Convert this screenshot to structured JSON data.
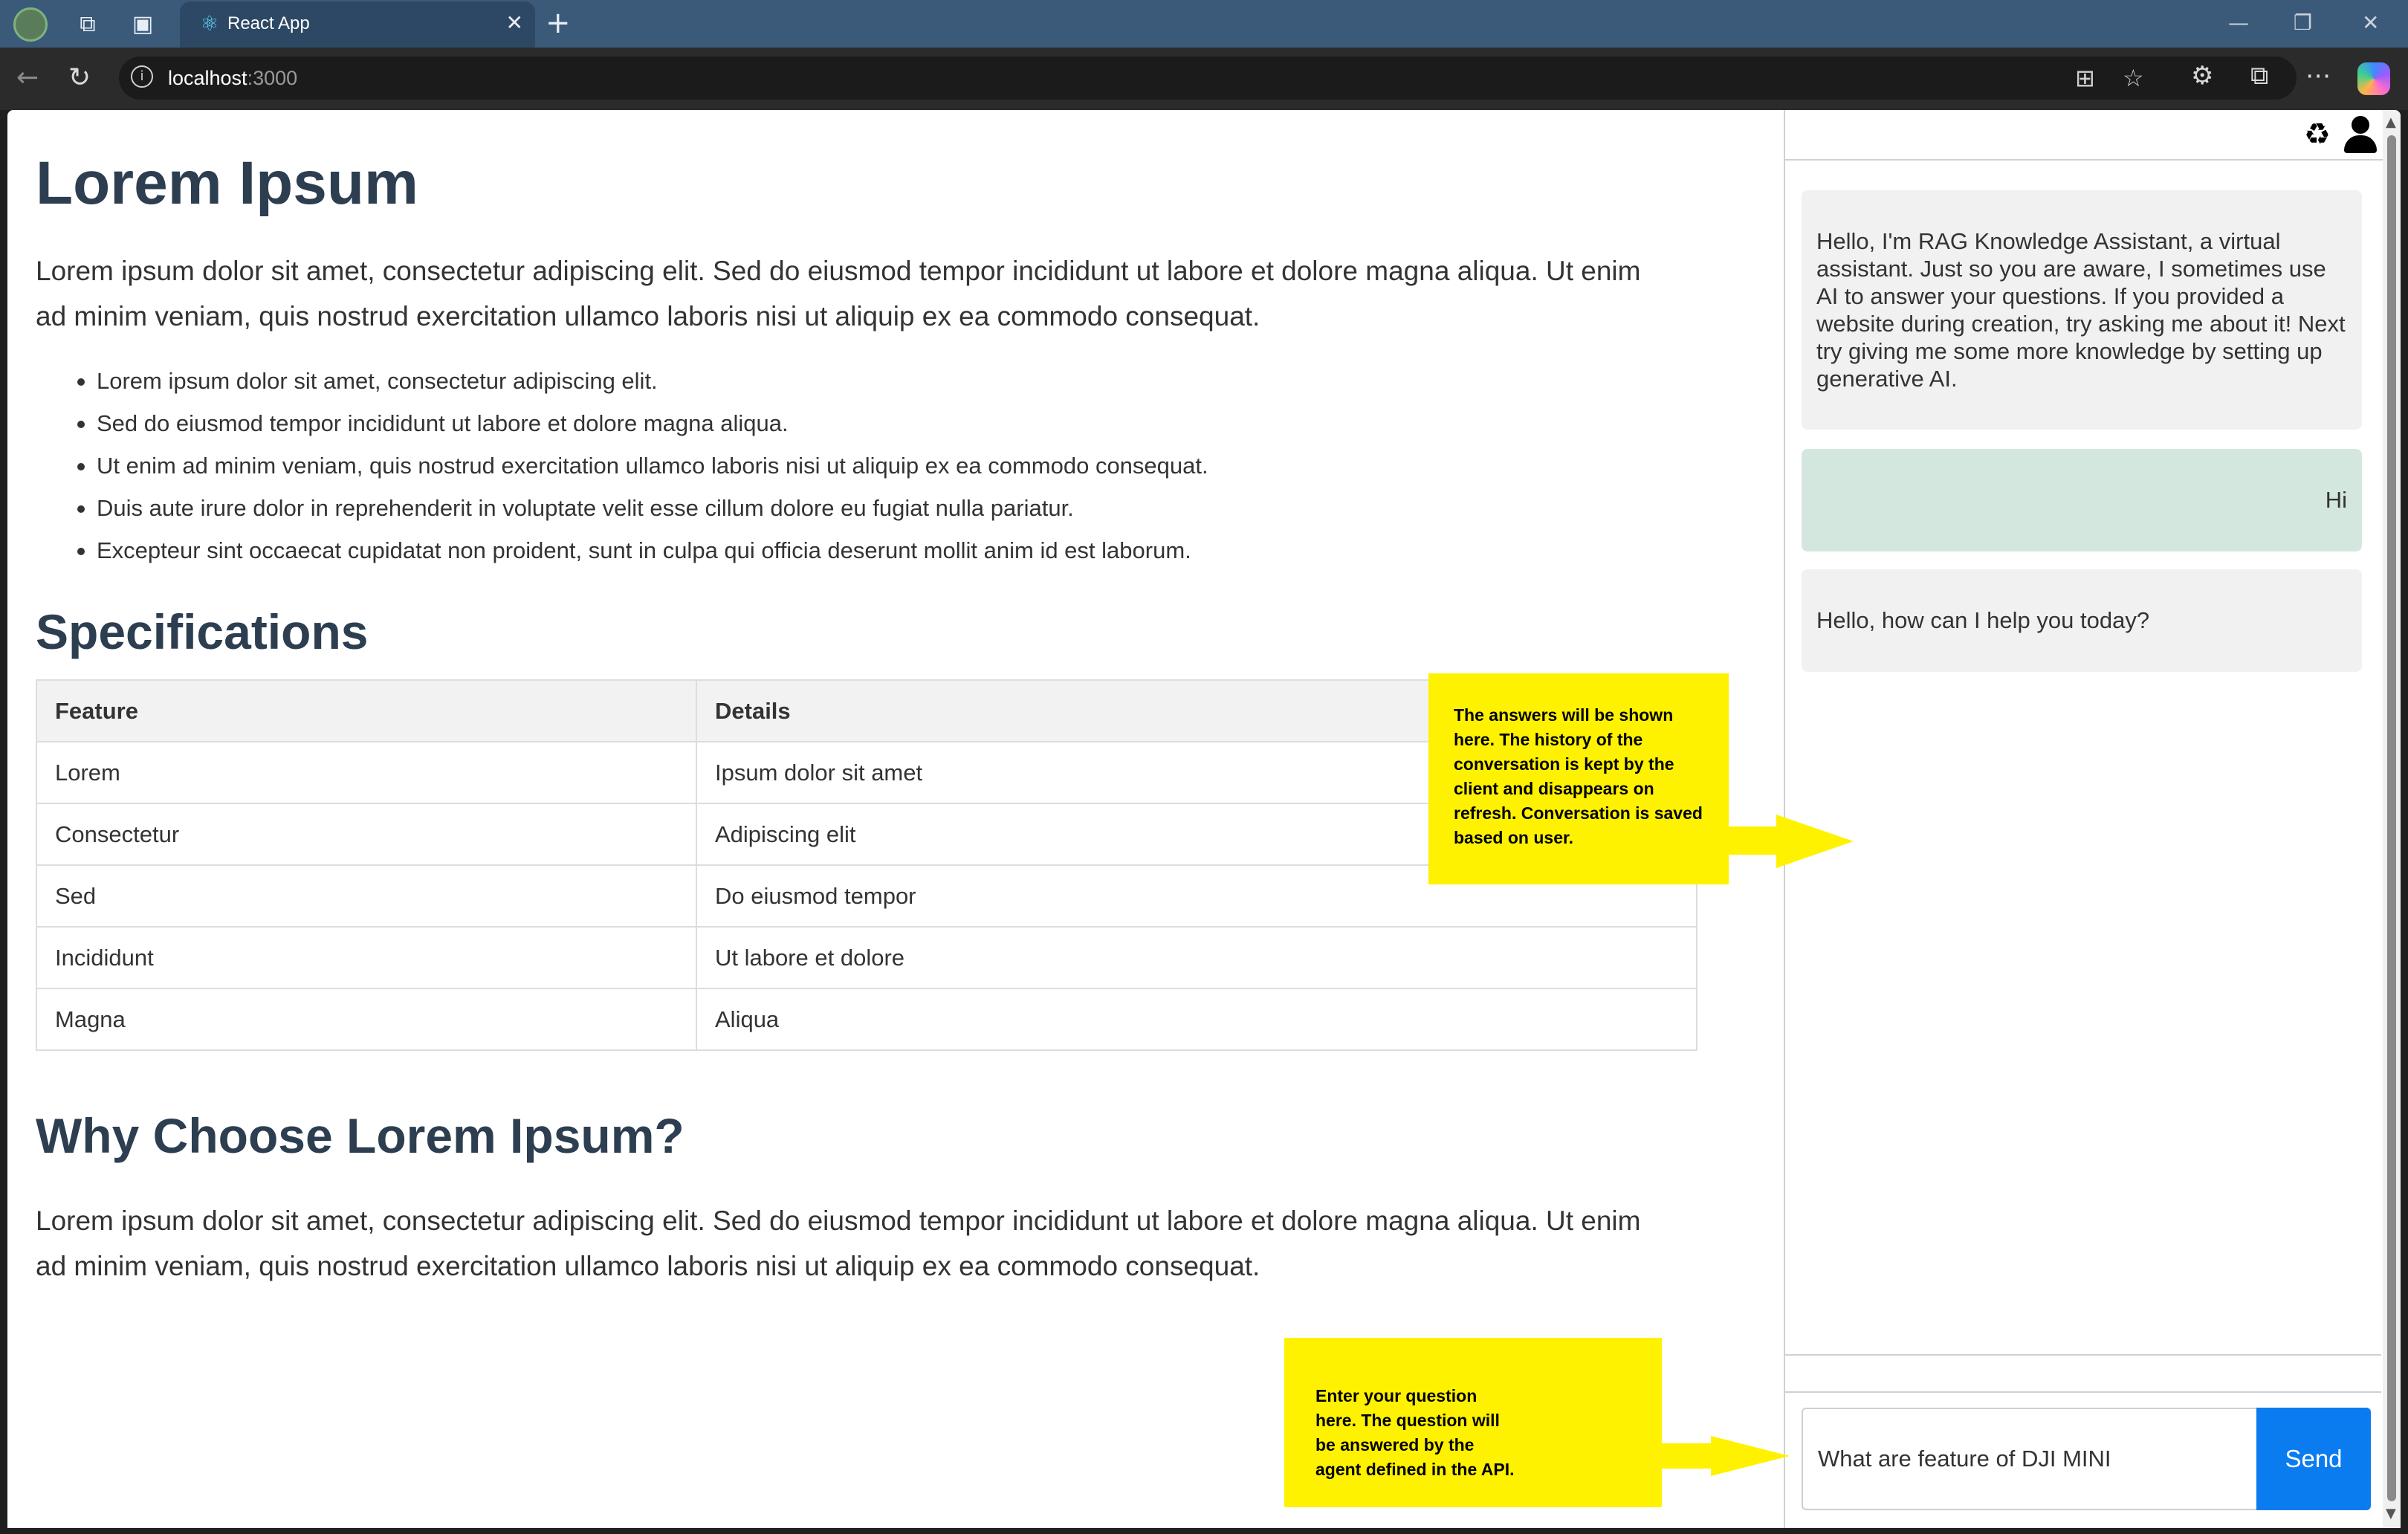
{
  "browser": {
    "tab_title": "React App",
    "url_host": "localhost",
    "url_port": ":3000"
  },
  "page": {
    "title": "Lorem Ipsum",
    "intro": "Lorem ipsum dolor sit amet, consectetur adipiscing elit. Sed do eiusmod tempor incididunt ut labore et dolore magna aliqua. Ut enim ad minim veniam, quis nostrud exercitation ullamco laboris nisi ut aliquip ex ea commodo consequat.",
    "bullets": [
      "Lorem ipsum dolor sit amet, consectetur adipiscing elit.",
      "Sed do eiusmod tempor incididunt ut labore et dolore magna aliqua.",
      "Ut enim ad minim veniam, quis nostrud exercitation ullamco laboris nisi ut aliquip ex ea commodo consequat.",
      "Duis aute irure dolor in reprehenderit in voluptate velit esse cillum dolore eu fugiat nulla pariatur.",
      "Excepteur sint occaecat cupidatat non proident, sunt in culpa qui officia deserunt mollit anim id est laborum."
    ],
    "spec_heading": "Specifications",
    "spec_table": {
      "headers": [
        "Feature",
        "Details"
      ],
      "rows": [
        [
          "Lorem",
          "Ipsum dolor sit amet"
        ],
        [
          "Consectetur",
          "Adipiscing elit"
        ],
        [
          "Sed",
          "Do eiusmod tempor"
        ],
        [
          "Incididunt",
          "Ut labore et dolore"
        ],
        [
          "Magna",
          "Aliqua"
        ]
      ]
    },
    "why_heading": "Why Choose Lorem Ipsum?",
    "why_text": "Lorem ipsum dolor sit amet, consectetur adipiscing elit. Sed do eiusmod tempor incididunt ut labore et dolore magna aliqua. Ut enim ad minim veniam, quis nostrud exercitation ullamco laboris nisi ut aliquip ex ea commodo consequat."
  },
  "chat": {
    "messages": [
      {
        "role": "bot",
        "text": "Hello, I'm RAG Knowledge Assistant, a virtual assistant. Just so you are aware, I sometimes use AI to answer your questions. If you provided a website during creation, try asking me about it! Next try giving me some more knowledge by setting up generative AI."
      },
      {
        "role": "user",
        "text": "Hi"
      },
      {
        "role": "bot",
        "text": "Hello, how can I help you today?"
      }
    ],
    "input_value": "What are feature of DJI MINI",
    "send_label": "Send"
  },
  "annotations": {
    "answers_note": "The answers will be shown here. The history of the conversation is kept by the client and disappears on refresh. Conversation is saved based on user.",
    "question_note": "Enter your question here. The question will be answered by the agent defined in the API."
  },
  "icons": [
    "profile-avatar-icon",
    "workspaces-icon",
    "vertical-tabs-icon",
    "react-favicon-icon",
    "close-tab-icon",
    "new-tab-icon",
    "minimize-icon",
    "restore-icon",
    "close-window-icon",
    "back-icon",
    "refresh-icon",
    "site-info-icon",
    "app-available-icon",
    "favorite-star-icon",
    "extensions-icon",
    "collections-icon",
    "more-icon",
    "copilot-icon",
    "recycle-icon",
    "user-icon"
  ]
}
